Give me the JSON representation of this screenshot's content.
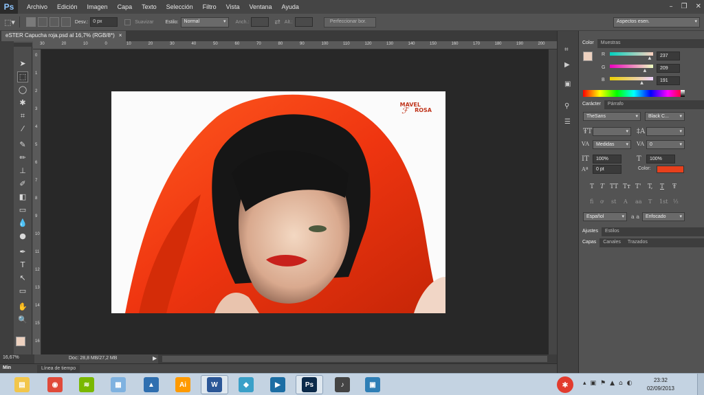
{
  "app": {
    "logo": "Ps"
  },
  "menu": [
    "Archivo",
    "Edición",
    "Imagen",
    "Capa",
    "Texto",
    "Selección",
    "Filtro",
    "Vista",
    "Ventana",
    "Ayuda"
  ],
  "options_bar": {
    "feather_label": "Desv.:",
    "feather_value": "0 px",
    "smooth_label": "Suavizar",
    "style_label": "Estilo:",
    "style_value": "Normal",
    "width_label": "Anch.:",
    "height_label": "Alt.:",
    "refine_label": "Perfeccionar bor.",
    "workspace_value": "Aspectos esen."
  },
  "document": {
    "tab_title": "eSTER Capucha roja.psd al 16,7% (RGB/8*)",
    "close_glyph": "×",
    "zoom": "16,67%",
    "doc_info": "Doc: 28,8 MB/27,2 MB",
    "watermark_line1": "MAVEL",
    "watermark_line2": "ROSA"
  },
  "rulers": {
    "h": [
      "30",
      "20",
      "10",
      "0",
      "10",
      "20",
      "30",
      "40",
      "50",
      "60",
      "70",
      "80",
      "90",
      "100",
      "110",
      "120",
      "130",
      "140",
      "150",
      "160",
      "170",
      "180",
      "190",
      "200"
    ],
    "v": [
      "0",
      "1",
      "2",
      "3",
      "4",
      "5",
      "6",
      "7",
      "8",
      "9",
      "10",
      "11",
      "12",
      "13",
      "14",
      "15",
      "16"
    ]
  },
  "timeline": {
    "label": "Línea de tiempo",
    "mini": "Min"
  },
  "color_panel": {
    "tabs": [
      "Color",
      "Muestras"
    ],
    "channels": [
      {
        "label": "R",
        "value": "237",
        "level": 0.93
      },
      {
        "label": "G",
        "value": "209",
        "level": 0.82
      },
      {
        "label": "B",
        "value": "191",
        "level": 0.75
      }
    ],
    "swatch": "#edd1bf"
  },
  "character_panel": {
    "tabs": [
      "Carácter",
      "Párrafo"
    ],
    "font_family": "TheSans",
    "font_style": "Black C...",
    "kerning": "Medidas",
    "tracking": "0",
    "vertical_scale": "100%",
    "horizontal_scale": "100%",
    "baseline": "0 pt",
    "color_label": "Color:",
    "text_color": "#e8401c",
    "language": "Español",
    "antialias_glyph": "a a",
    "antialias": "Enfocado",
    "type_styles": [
      "T",
      "T",
      "TT",
      "Tт",
      "T'",
      "T,",
      "T",
      "Ŧ"
    ],
    "ot_styles": [
      "fi",
      "ơ",
      "st",
      "A",
      "aa",
      "T",
      "1st",
      "½"
    ]
  },
  "adjust_panel": {
    "tabs": [
      "Ajustes",
      "Estilos"
    ]
  },
  "layers_panel": {
    "tabs": [
      "Capas",
      "Canales",
      "Trazados"
    ]
  },
  "taskbar": {
    "time": "23:32",
    "date": "02/09/2013",
    "apps": [
      {
        "name": "explorer",
        "glyph": "▤",
        "color": "#f2c64a"
      },
      {
        "name": "chrome",
        "glyph": "◉",
        "color": "#e04a3a"
      },
      {
        "name": "spotify",
        "glyph": "≋",
        "color": "#7ab800"
      },
      {
        "name": "notes",
        "glyph": "▦",
        "color": "#7fb2e0"
      },
      {
        "name": "autocad",
        "glyph": "▲",
        "color": "#2f6fb0"
      },
      {
        "name": "illustrator",
        "glyph": "Ai",
        "color": "#ff9a00"
      },
      {
        "name": "word",
        "glyph": "W",
        "color": "#2b5797"
      },
      {
        "name": "cube",
        "glyph": "◆",
        "color": "#3aa0c8"
      },
      {
        "name": "media",
        "glyph": "▶",
        "color": "#1c6ea4"
      },
      {
        "name": "photoshop",
        "glyph": "Ps",
        "color": "#0b2a4a"
      },
      {
        "name": "microphone",
        "glyph": "♪",
        "color": "#444444"
      },
      {
        "name": "viewer",
        "glyph": "▣",
        "color": "#2f7fb6"
      }
    ]
  }
}
